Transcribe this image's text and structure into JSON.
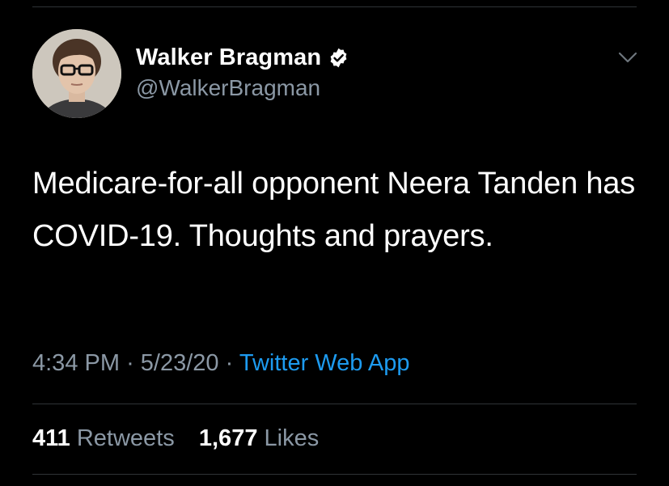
{
  "tweet": {
    "author": {
      "display_name": "Walker Bragman",
      "handle": "@WalkerBragman",
      "verified": true
    },
    "text": "Medicare-for-all opponent Neera Tanden has COVID-19. Thoughts and prayers.",
    "time": "4:34 PM",
    "separator": "·",
    "date": "5/23/20",
    "source": "Twitter Web App",
    "stats": {
      "retweets_count": "411",
      "retweets_label": "Retweets",
      "likes_count": "1,677",
      "likes_label": "Likes"
    }
  },
  "icons": {
    "verified": "verified-badge-icon",
    "menu": "chevron-down-icon"
  },
  "colors": {
    "background": "#000000",
    "primary_text": "#ffffff",
    "secondary_text": "#8b98a5",
    "link": "#1d9bf0",
    "divider": "#2f3336"
  }
}
